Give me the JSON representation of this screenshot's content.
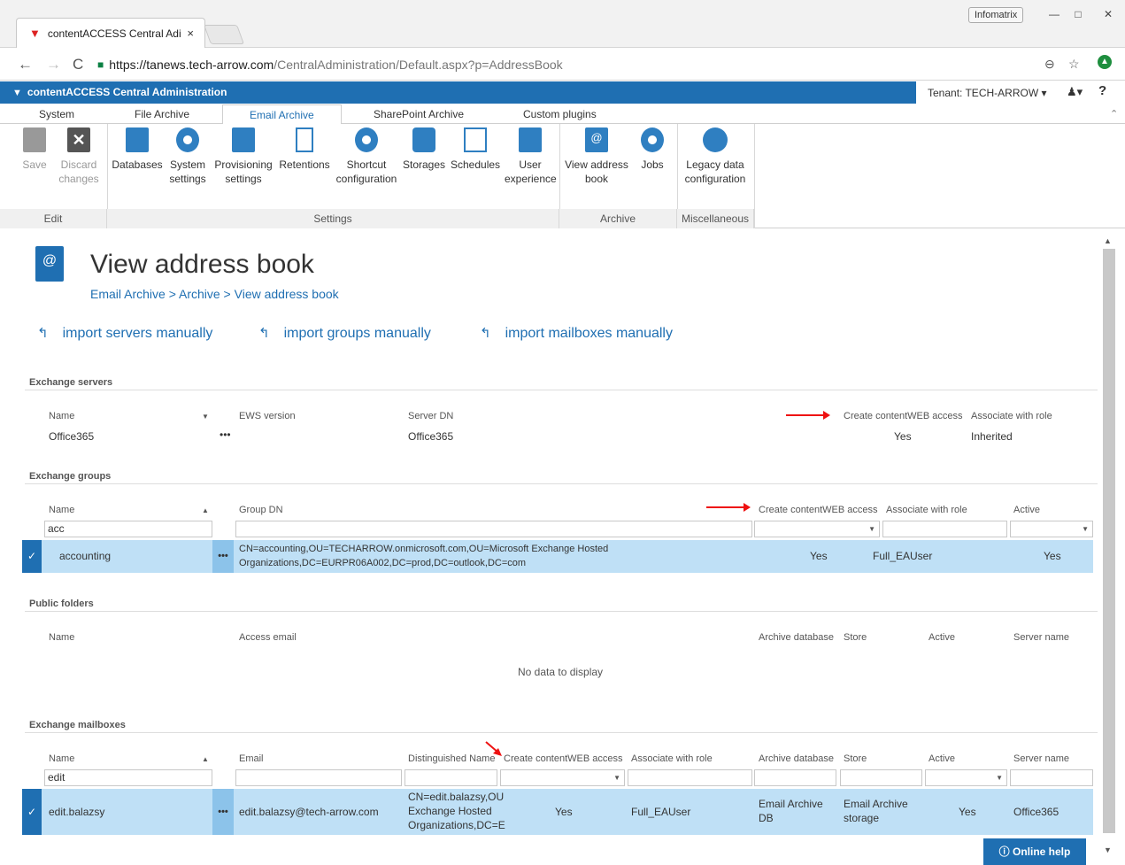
{
  "browser": {
    "tab_title": "contentACCESS Central Adi",
    "tab_close": "×",
    "profile": "Infomatrix",
    "url_host": "https://tanews.tech-arrow.com",
    "url_path": "/CentralAdministration/Default.aspx?p=AddressBook"
  },
  "app": {
    "name": "contentACCESS Central Administration",
    "tenant": "Tenant: TECH-ARROW"
  },
  "ribbon_tabs": [
    "System",
    "File Archive",
    "Email Archive",
    "SharePoint Archive",
    "Custom plugins"
  ],
  "ribbon": {
    "save": "Save",
    "discard": "Discard changes",
    "databases": "Databases",
    "system_settings": "System settings",
    "provisioning_settings": "Provisioning settings",
    "retentions": "Retentions",
    "shortcut_configuration": "Shortcut configuration",
    "storages": "Storages",
    "schedules": "Schedules",
    "user_experience": "User experience",
    "view_address_book": "View address book",
    "jobs": "Jobs",
    "legacy_data_configuration": "Legacy data configuration",
    "groups": {
      "edit": "Edit",
      "settings": "Settings",
      "archive": "Archive",
      "misc": "Miscellaneous"
    }
  },
  "page": {
    "title": "View address book",
    "breadcrumb": "Email Archive > Archive > View address book",
    "actions": [
      "import servers manually",
      "import groups manually",
      "import mailboxes manually"
    ]
  },
  "exchange_servers": {
    "title": "Exchange servers",
    "headers": {
      "name": "Name",
      "ews": "EWS version",
      "server_dn": "Server DN",
      "create": "Create contentWEB access",
      "role": "Associate with role"
    },
    "row": {
      "name": "Office365",
      "dots": "•••",
      "server_dn": "Office365",
      "create": "Yes",
      "role": "Inherited"
    }
  },
  "exchange_groups": {
    "title": "Exchange groups",
    "headers": {
      "name": "Name",
      "group_dn": "Group DN",
      "create": "Create contentWEB access",
      "role": "Associate with role",
      "active": "Active"
    },
    "filter_name": "acc",
    "row": {
      "name": "accounting",
      "dn_line1": "CN=accounting,OU=TECHARROW.onmicrosoft.com,OU=Microsoft Exchange Hosted",
      "dn_line2": "Organizations,DC=EURPR06A002,DC=prod,DC=outlook,DC=com",
      "create": "Yes",
      "role": "Full_EAUser",
      "active": "Yes"
    }
  },
  "public_folders": {
    "title": "Public folders",
    "headers": {
      "name": "Name",
      "access_email": "Access email",
      "archive_db": "Archive database",
      "store": "Store",
      "active": "Active",
      "server_name": "Server name"
    },
    "empty": "No data to display"
  },
  "exchange_mailboxes": {
    "title": "Exchange mailboxes",
    "headers": {
      "name": "Name",
      "email": "Email",
      "dn": "Distinguished Name",
      "create": "Create contentWEB access",
      "role": "Associate with role",
      "archive_db": "Archive database",
      "store": "Store",
      "active": "Active",
      "server_name": "Server name"
    },
    "filter_name": "edit",
    "row": {
      "name": "edit.balazsy",
      "email": "edit.balazsy@tech-arrow.com",
      "dn_line1": "CN=edit.balazsy,OU",
      "dn_line2": "Exchange Hosted",
      "dn_line3": "Organizations,DC=E",
      "create": "Yes",
      "role": "Full_EAUser",
      "archive_db_line1": "Email Archive",
      "archive_db_line2": "DB",
      "store_line1": "Email Archive",
      "store_line2": "storage",
      "active": "Yes",
      "server_name": "Office365"
    }
  },
  "online_help": "Online help"
}
